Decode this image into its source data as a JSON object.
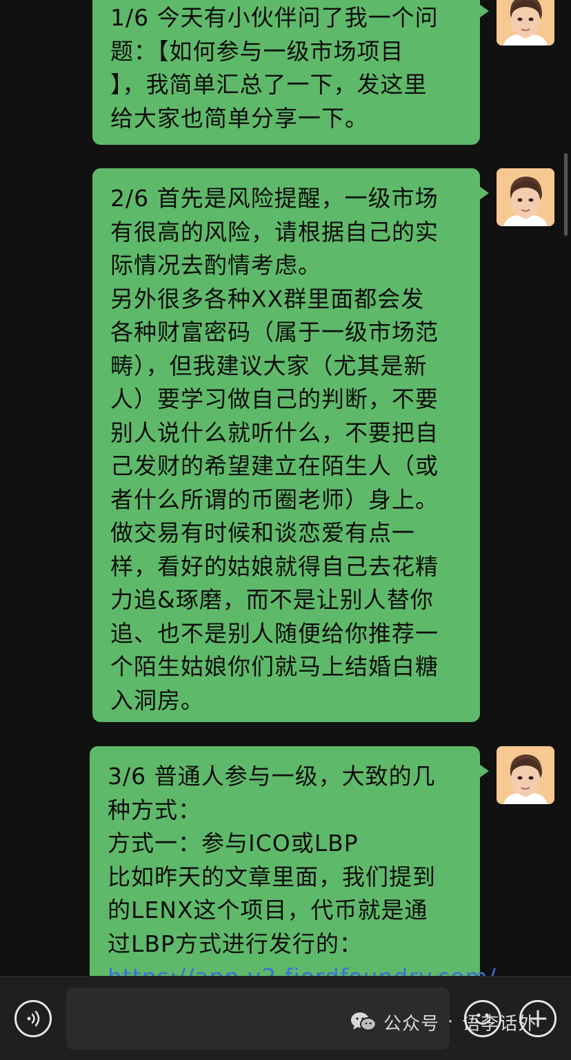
{
  "messages": [
    {
      "lines": [
        "1/6 今天有小伙伴问了我一个问",
        "题：【如何参与一级市场项目",
        "】，我简单汇总了一下，发这里",
        "给大家也简单分享一下。"
      ]
    },
    {
      "lines": [
        "2/6 首先是风险提醒，一级市场",
        "有很高的风险，请根据自己的实",
        "际情况去酌情考虑。",
        "另外很多各种XX群里面都会发",
        "各种财富密码（属于一级市场范",
        "畴），但我建议大家（尤其是新",
        "人）要学习做自己的判断，不要",
        "别人说什么就听什么，不要把自",
        "己发财的希望建立在陌生人（或",
        "者什么所谓的币圈老师）身上。",
        "做交易有时候和谈恋爱有点一",
        "样，看好的姑娘就得自己去花精",
        "力追&琢磨，而不是让别人替你",
        "追、也不是别人随便给你推荐一",
        "个陌生姑娘你们就马上结婚白糖",
        "入洞房。"
      ]
    },
    {
      "lines": [
        "3/6 普通人参与一级，大致的几",
        "种方式：",
        "方式一：参与ICO或LBP",
        "比如昨天的文章里面，我们提到",
        "的LENX这个项目，代币就是通",
        "过LBP方式进行发行的："
      ],
      "link": "https://app.v2.fjordfoundry.com/"
    }
  ],
  "input_bar": {
    "voice_icon": "voice-icon",
    "emoji_icon": "emoji-icon",
    "plus_icon": "plus-icon"
  },
  "watermark": {
    "icon": "wechat-icon",
    "label": "公众号",
    "dot": "·",
    "account": "语李话外"
  },
  "colors": {
    "background": "#111111",
    "bubble": "#5fb96a",
    "link": "#3a6fd8"
  }
}
